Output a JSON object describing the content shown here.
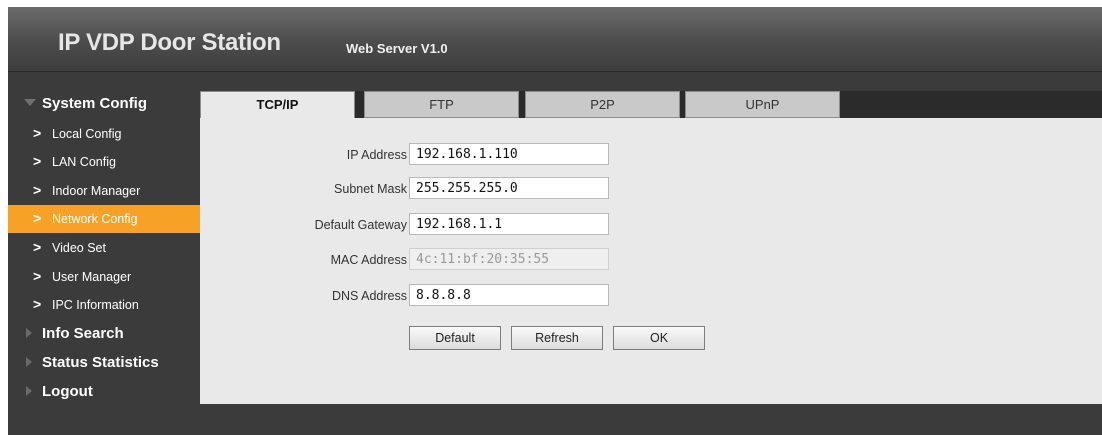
{
  "header": {
    "title": "IP VDP Door Station",
    "subtitle": "Web Server V1.0"
  },
  "sidebar": {
    "system_config": {
      "label": "System Config",
      "expanded": true
    },
    "items": [
      {
        "label": "Local Config",
        "active": false
      },
      {
        "label": "LAN Config",
        "active": false
      },
      {
        "label": "Indoor Manager",
        "active": false
      },
      {
        "label": "Network Config",
        "active": true
      },
      {
        "label": "Video Set",
        "active": false
      },
      {
        "label": "User Manager",
        "active": false
      },
      {
        "label": "IPC Information",
        "active": false
      }
    ],
    "arrow_glyph": ">",
    "groups": [
      {
        "label": "Info Search",
        "expanded": false
      },
      {
        "label": "Status Statistics",
        "expanded": false
      },
      {
        "label": "Logout",
        "expanded": false
      }
    ]
  },
  "tabs": [
    {
      "label": "TCP/IP",
      "active": true
    },
    {
      "label": "FTP",
      "active": false
    },
    {
      "label": "P2P",
      "active": false
    },
    {
      "label": "UPnP",
      "active": false
    }
  ],
  "form": {
    "ip_address": {
      "label": "IP Address",
      "value": "192.168.1.110"
    },
    "subnet_mask": {
      "label": "Subnet Mask",
      "value": "255.255.255.0"
    },
    "default_gateway": {
      "label": "Default Gateway",
      "value": "192.168.1.1"
    },
    "mac_address": {
      "label": "MAC Address",
      "value": "4c:11:bf:20:35:55",
      "disabled": true
    },
    "dns_address": {
      "label": "DNS Address",
      "value": "8.8.8.8"
    }
  },
  "buttons": {
    "default": "Default",
    "refresh": "Refresh",
    "ok": "OK"
  },
  "colors": {
    "accent": "#f7a227",
    "background": "#3b3b3b",
    "panel": "#e9e9e9"
  }
}
